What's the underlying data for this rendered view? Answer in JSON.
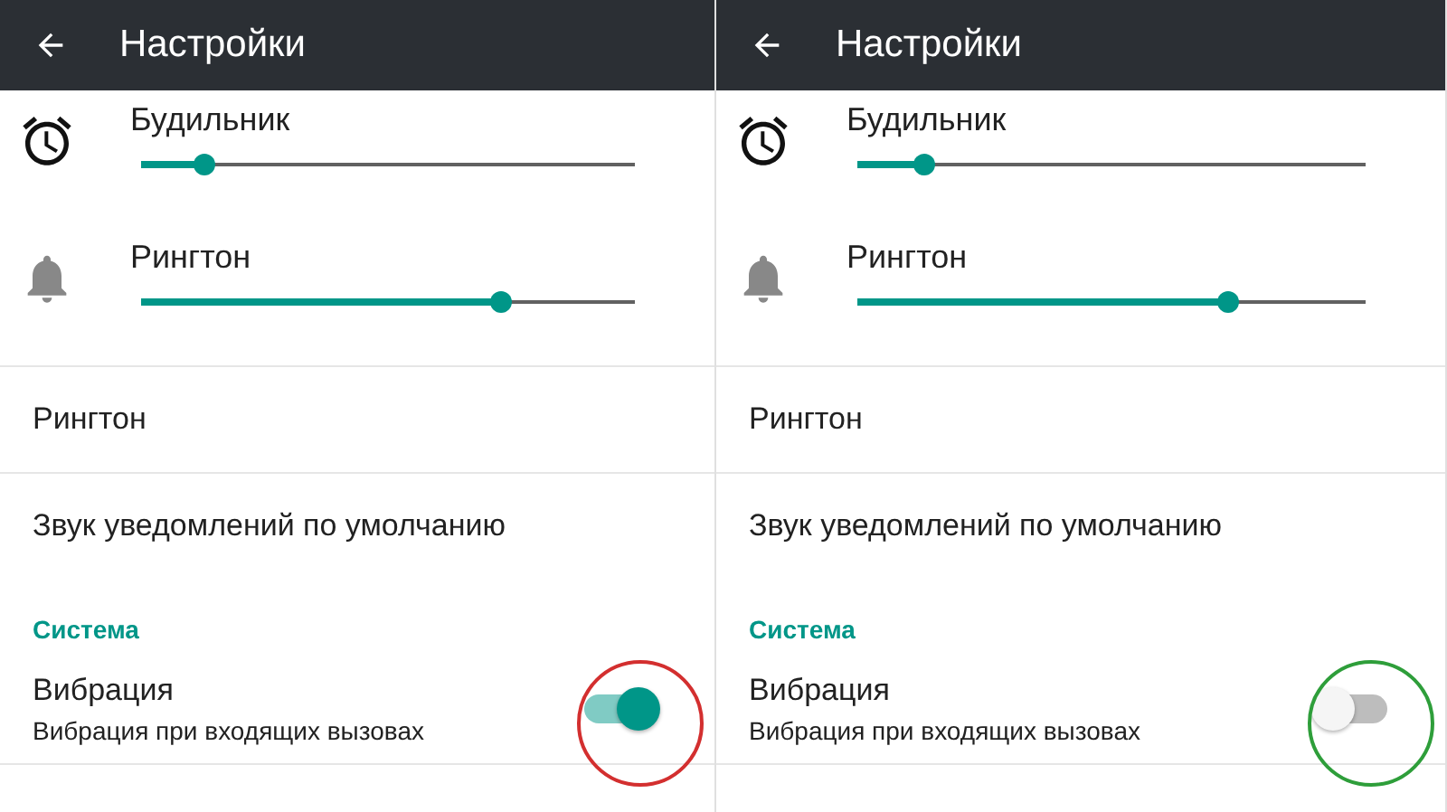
{
  "panels": [
    {
      "title": "Настройки",
      "sliders": [
        {
          "kind": "alarm",
          "label": "Будильник",
          "level": 0.13
        },
        {
          "kind": "bell",
          "label": "Рингтон",
          "level": 0.73
        }
      ],
      "items": [
        "Рингтон",
        "Звук уведомлений по умолчанию"
      ],
      "section": "Система",
      "vibration": {
        "title": "Вибрация",
        "subtitle": "Вибрация при входящих вызовах",
        "on": true
      },
      "highlight": {
        "color": "#d32f2f"
      }
    },
    {
      "title": "Настройки",
      "sliders": [
        {
          "kind": "alarm",
          "label": "Будильник",
          "level": 0.13
        },
        {
          "kind": "bell",
          "label": "Рингтон",
          "level": 0.73
        }
      ],
      "items": [
        "Рингтон",
        "Звук уведомлений по умолчанию"
      ],
      "section": "Система",
      "vibration": {
        "title": "Вибрация",
        "subtitle": "Вибрация при входящих вызовах",
        "on": false
      },
      "highlight": {
        "color": "#2e9e3a"
      }
    }
  ]
}
